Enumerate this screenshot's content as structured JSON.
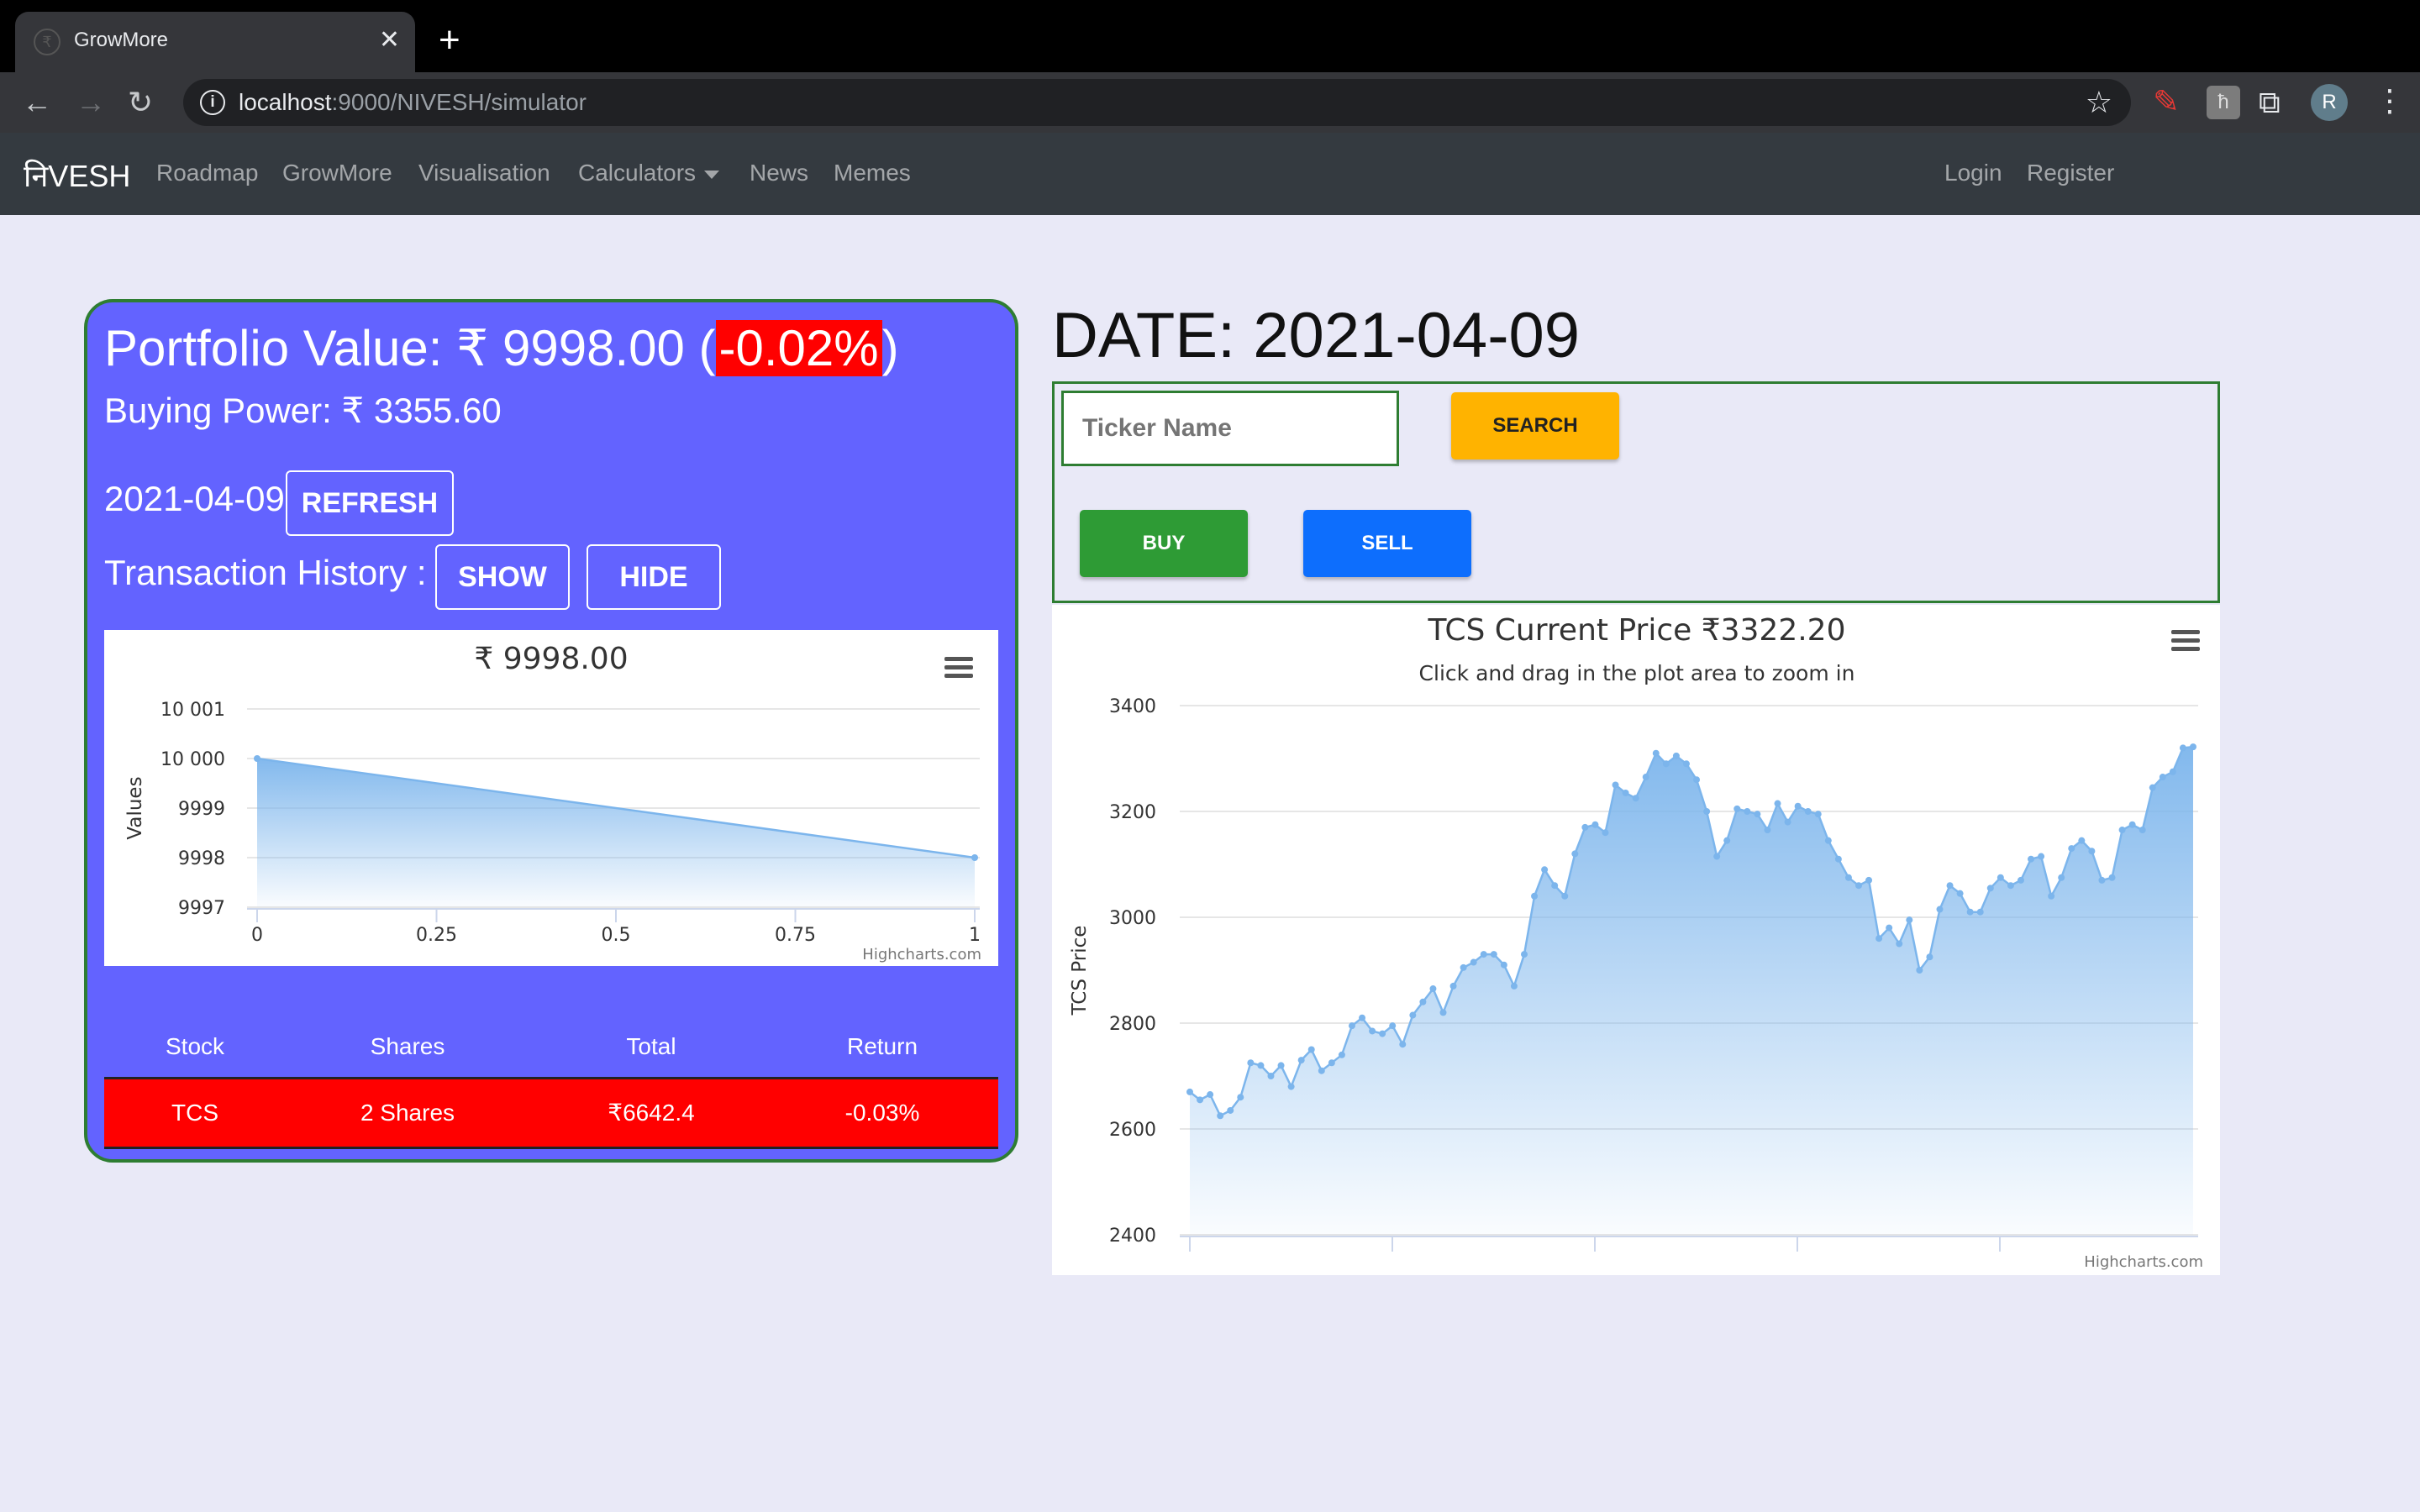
{
  "browser": {
    "tab_title": "GrowMore",
    "tab_close": "✕",
    "new_tab": "+",
    "url_host": "localhost",
    "url_path": ":9000/NIVESH/simulator"
  },
  "navbar": {
    "brand": "निVESH",
    "links": [
      "Roadmap",
      "GrowMore",
      "Visualisation",
      "Calculators",
      "News",
      "Memes"
    ],
    "login": "Login",
    "register": "Register"
  },
  "portfolio": {
    "value_label": "Portfolio Value: ₹ 9998.00 (",
    "change": "-0.02%",
    "value_close": ")",
    "buying_power": "Buying Power: ₹ 3355.60",
    "date": "2021-04-09",
    "refresh_label": "REFRESH",
    "history_label": "Transaction History :",
    "show_label": "SHOW",
    "hide_label": "HIDE",
    "table": {
      "headers": [
        "Stock",
        "Shares",
        "Total",
        "Return"
      ],
      "rows": [
        {
          "stock": "TCS",
          "shares": "2 Shares",
          "total": "₹6642.4",
          "return": "-0.03%"
        }
      ]
    }
  },
  "trade": {
    "date_title": "DATE: 2021-04-09",
    "ticker_placeholder": "Ticker Name",
    "search_label": "SEARCH",
    "buy_label": "BUY",
    "sell_label": "SELL"
  },
  "colors": {
    "card_bg": "#6363ff",
    "negative": "#ff0000",
    "series": "#7cb5ec",
    "buy": "#2e9b35",
    "sell": "#0d6efd",
    "search": "#ffb300"
  },
  "chart_data": [
    {
      "type": "area",
      "title": "₹ 9998.00",
      "ylabel": "Values",
      "credits": "Highcharts.com",
      "x": [
        0,
        1
      ],
      "values": [
        10000,
        9998
      ],
      "xticks": [
        "0",
        "0.25",
        "0.5",
        "0.75",
        "1"
      ],
      "yticks": [
        "9997",
        "9998",
        "9999",
        "10 000",
        "10 001"
      ],
      "xlim": [
        0,
        1
      ],
      "ylim": [
        9997,
        10001
      ]
    },
    {
      "type": "area",
      "title": "TCS Current Price ₹3322.20",
      "subtitle": "Click and drag in the plot area to zoom in",
      "ylabel": "TCS Price",
      "credits": "Highcharts.com",
      "yticks": [
        "2400",
        "2600",
        "2800",
        "3000",
        "3200",
        "3400"
      ],
      "ylim": [
        2400,
        3400
      ],
      "values": [
        2670,
        2655,
        2665,
        2625,
        2635,
        2660,
        2725,
        2720,
        2700,
        2720,
        2680,
        2730,
        2750,
        2710,
        2725,
        2740,
        2795,
        2810,
        2785,
        2780,
        2795,
        2760,
        2815,
        2840,
        2865,
        2820,
        2870,
        2905,
        2915,
        2930,
        2930,
        2910,
        2870,
        2930,
        3040,
        3090,
        3060,
        3040,
        3120,
        3170,
        3175,
        3160,
        3250,
        3235,
        3225,
        3265,
        3310,
        3290,
        3305,
        3290,
        3260,
        3200,
        3115,
        3145,
        3205,
        3200,
        3195,
        3165,
        3215,
        3180,
        3210,
        3200,
        3195,
        3145,
        3110,
        3075,
        3060,
        3070,
        2960,
        2980,
        2950,
        2995,
        2900,
        2925,
        3015,
        3060,
        3045,
        3010,
        3010,
        3055,
        3075,
        3060,
        3070,
        3110,
        3115,
        3040,
        3075,
        3130,
        3145,
        3125,
        3070,
        3075,
        3165,
        3175,
        3165,
        3245,
        3265,
        3275,
        3320,
        3322
      ]
    }
  ]
}
